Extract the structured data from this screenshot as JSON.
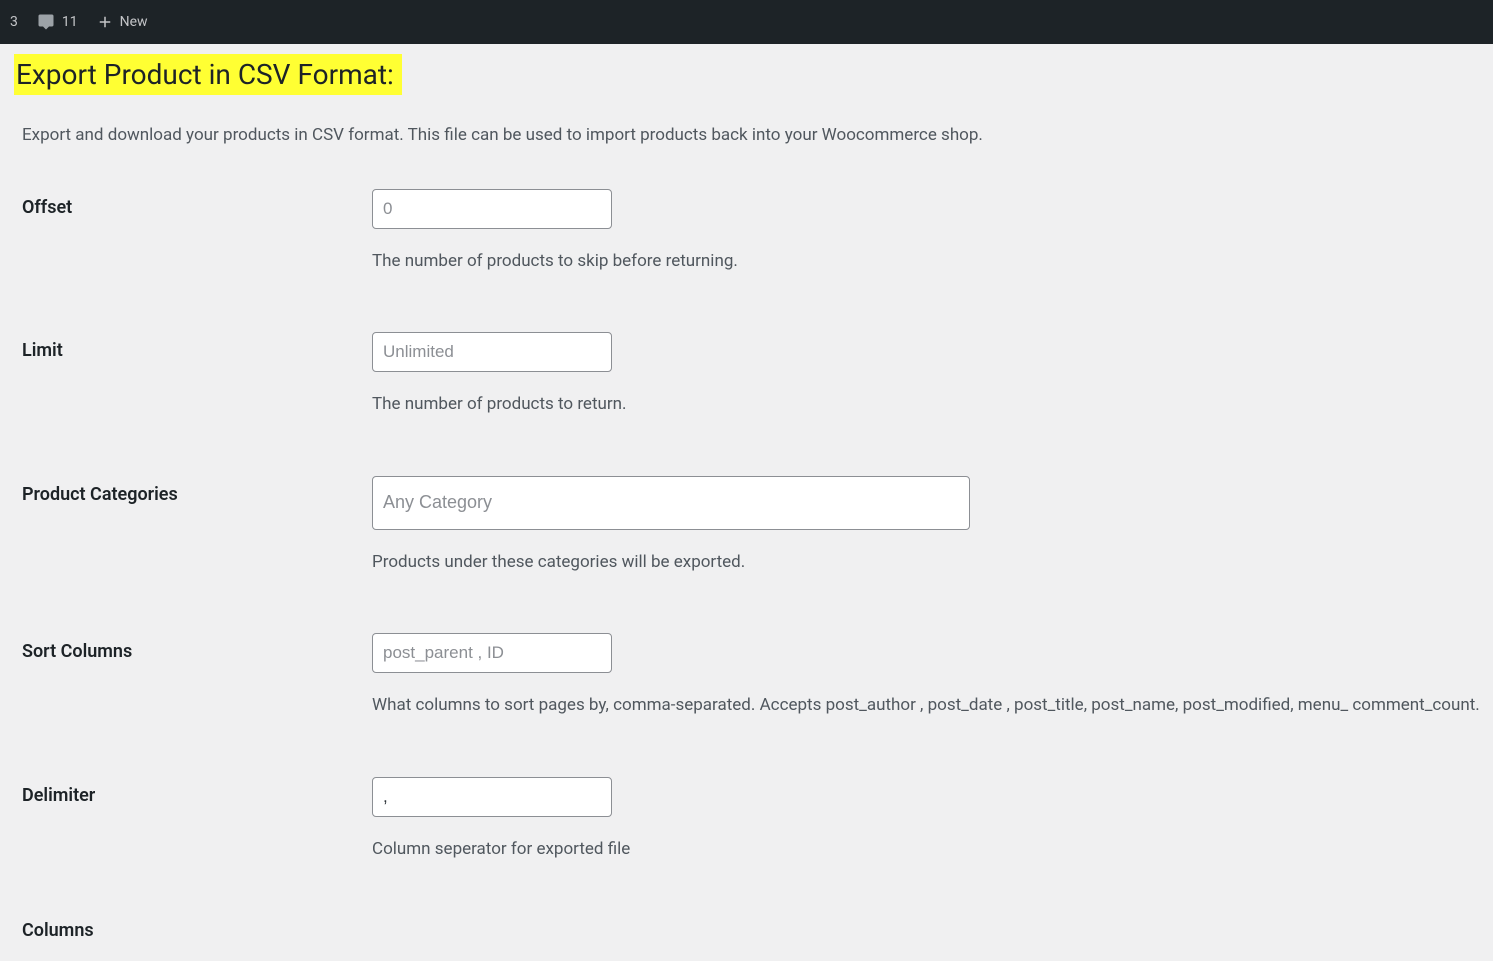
{
  "adminBar": {
    "updates": "3",
    "comments": "11",
    "newLabel": "New"
  },
  "page": {
    "title": "Export Product in CSV Format:",
    "description": "Export and download your products in CSV format. This file can be used to import products back into your Woocommerce shop."
  },
  "fields": {
    "offset": {
      "label": "Offset",
      "placeholder": "0",
      "help": "The number of products to skip before returning."
    },
    "limit": {
      "label": "Limit",
      "placeholder": "Unlimited",
      "help": "The number of products to return."
    },
    "categories": {
      "label": "Product Categories",
      "placeholder": "Any Category",
      "help": "Products under these categories will be exported."
    },
    "sort": {
      "label": "Sort Columns",
      "placeholder": "post_parent , ID",
      "help": "What columns to sort pages by, comma-separated. Accepts post_author , post_date , post_title, post_name, post_modified, menu_ comment_count."
    },
    "delimiter": {
      "label": "Delimiter",
      "value": ",",
      "help": "Column seperator for exported file"
    },
    "columns": {
      "label": "Columns"
    }
  }
}
